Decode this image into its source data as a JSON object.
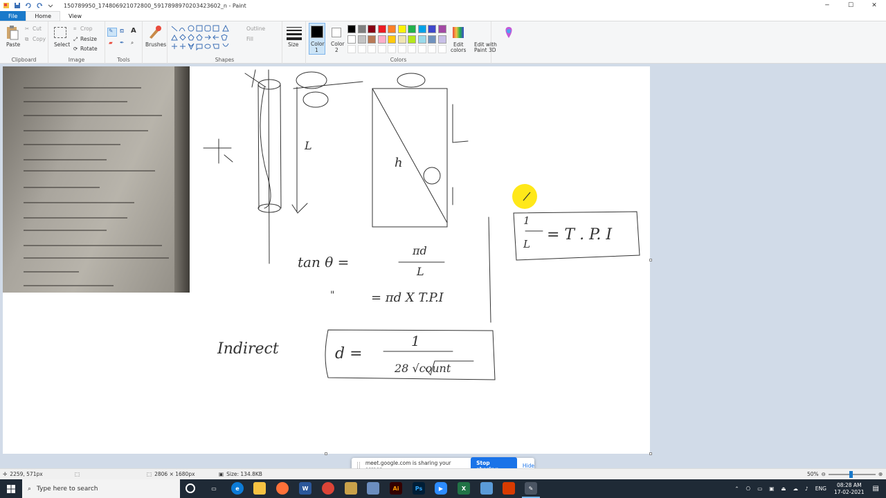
{
  "window": {
    "title": "150789950_174806921072800_5917898970203423602_n - Paint",
    "controls": {
      "minimize": "─",
      "maximize": "☐",
      "close": "✕"
    }
  },
  "menu": {
    "file": "File",
    "home": "Home",
    "view": "View"
  },
  "ribbon": {
    "clipboard": {
      "paste": "Paste",
      "cut": "Cut",
      "copy": "Copy",
      "label": "Clipboard"
    },
    "image": {
      "select": "Select",
      "crop": "Crop",
      "resize": "Resize",
      "rotate": "Rotate",
      "label": "Image"
    },
    "tools": {
      "label": "Tools"
    },
    "brushes": {
      "label": "Brushes"
    },
    "shapes": {
      "outline": "Outline",
      "fill": "Fill",
      "label": "Shapes"
    },
    "size": {
      "label": "Size"
    },
    "colors": {
      "color1": "Color\n1",
      "color1_a": "Color",
      "color1_b": "1",
      "color2_a": "Color",
      "color2_b": "2",
      "edit_colors_a": "Edit",
      "edit_colors_b": "colors",
      "label": "Colors",
      "palette": [
        "#000000",
        "#7f7f7f",
        "#880015",
        "#ed1c24",
        "#ff7f27",
        "#fff200",
        "#22b14c",
        "#00a2e8",
        "#3f48cc",
        "#a349a4",
        "#ffffff",
        "#c3c3c3",
        "#b97a57",
        "#ffaec9",
        "#ffc90e",
        "#efe4b0",
        "#b5e61d",
        "#99d9ea",
        "#7092be",
        "#c8bfe7"
      ]
    },
    "paint3d": {
      "line1": "Edit with",
      "line2": "Paint 3D"
    }
  },
  "canvas": {
    "formulas": {
      "tan1": "tan θ =",
      "pi_d": "πd",
      "L": "L",
      "dxtpi": "= πd X T.P.I",
      "ditto": "\"",
      "L_eq": "L",
      "tpi": "= T . P. I",
      "one": "1",
      "indirect": "Indirect",
      "d_eq": "d =",
      "denom": "28 √count",
      "h": "h"
    }
  },
  "share_bar": {
    "message": "meet.google.com is sharing your screen.",
    "stop": "Stop sharing",
    "hide": "Hide"
  },
  "status": {
    "cursor": "2259, 571px",
    "dimensions": "2806 × 1680px",
    "size": "Size: 134.8KB",
    "zoom": "50%"
  },
  "taskbar": {
    "search_placeholder": "Type here to search",
    "lang": "ENG",
    "time": "08:28 AM",
    "date": "17-02-2021"
  }
}
